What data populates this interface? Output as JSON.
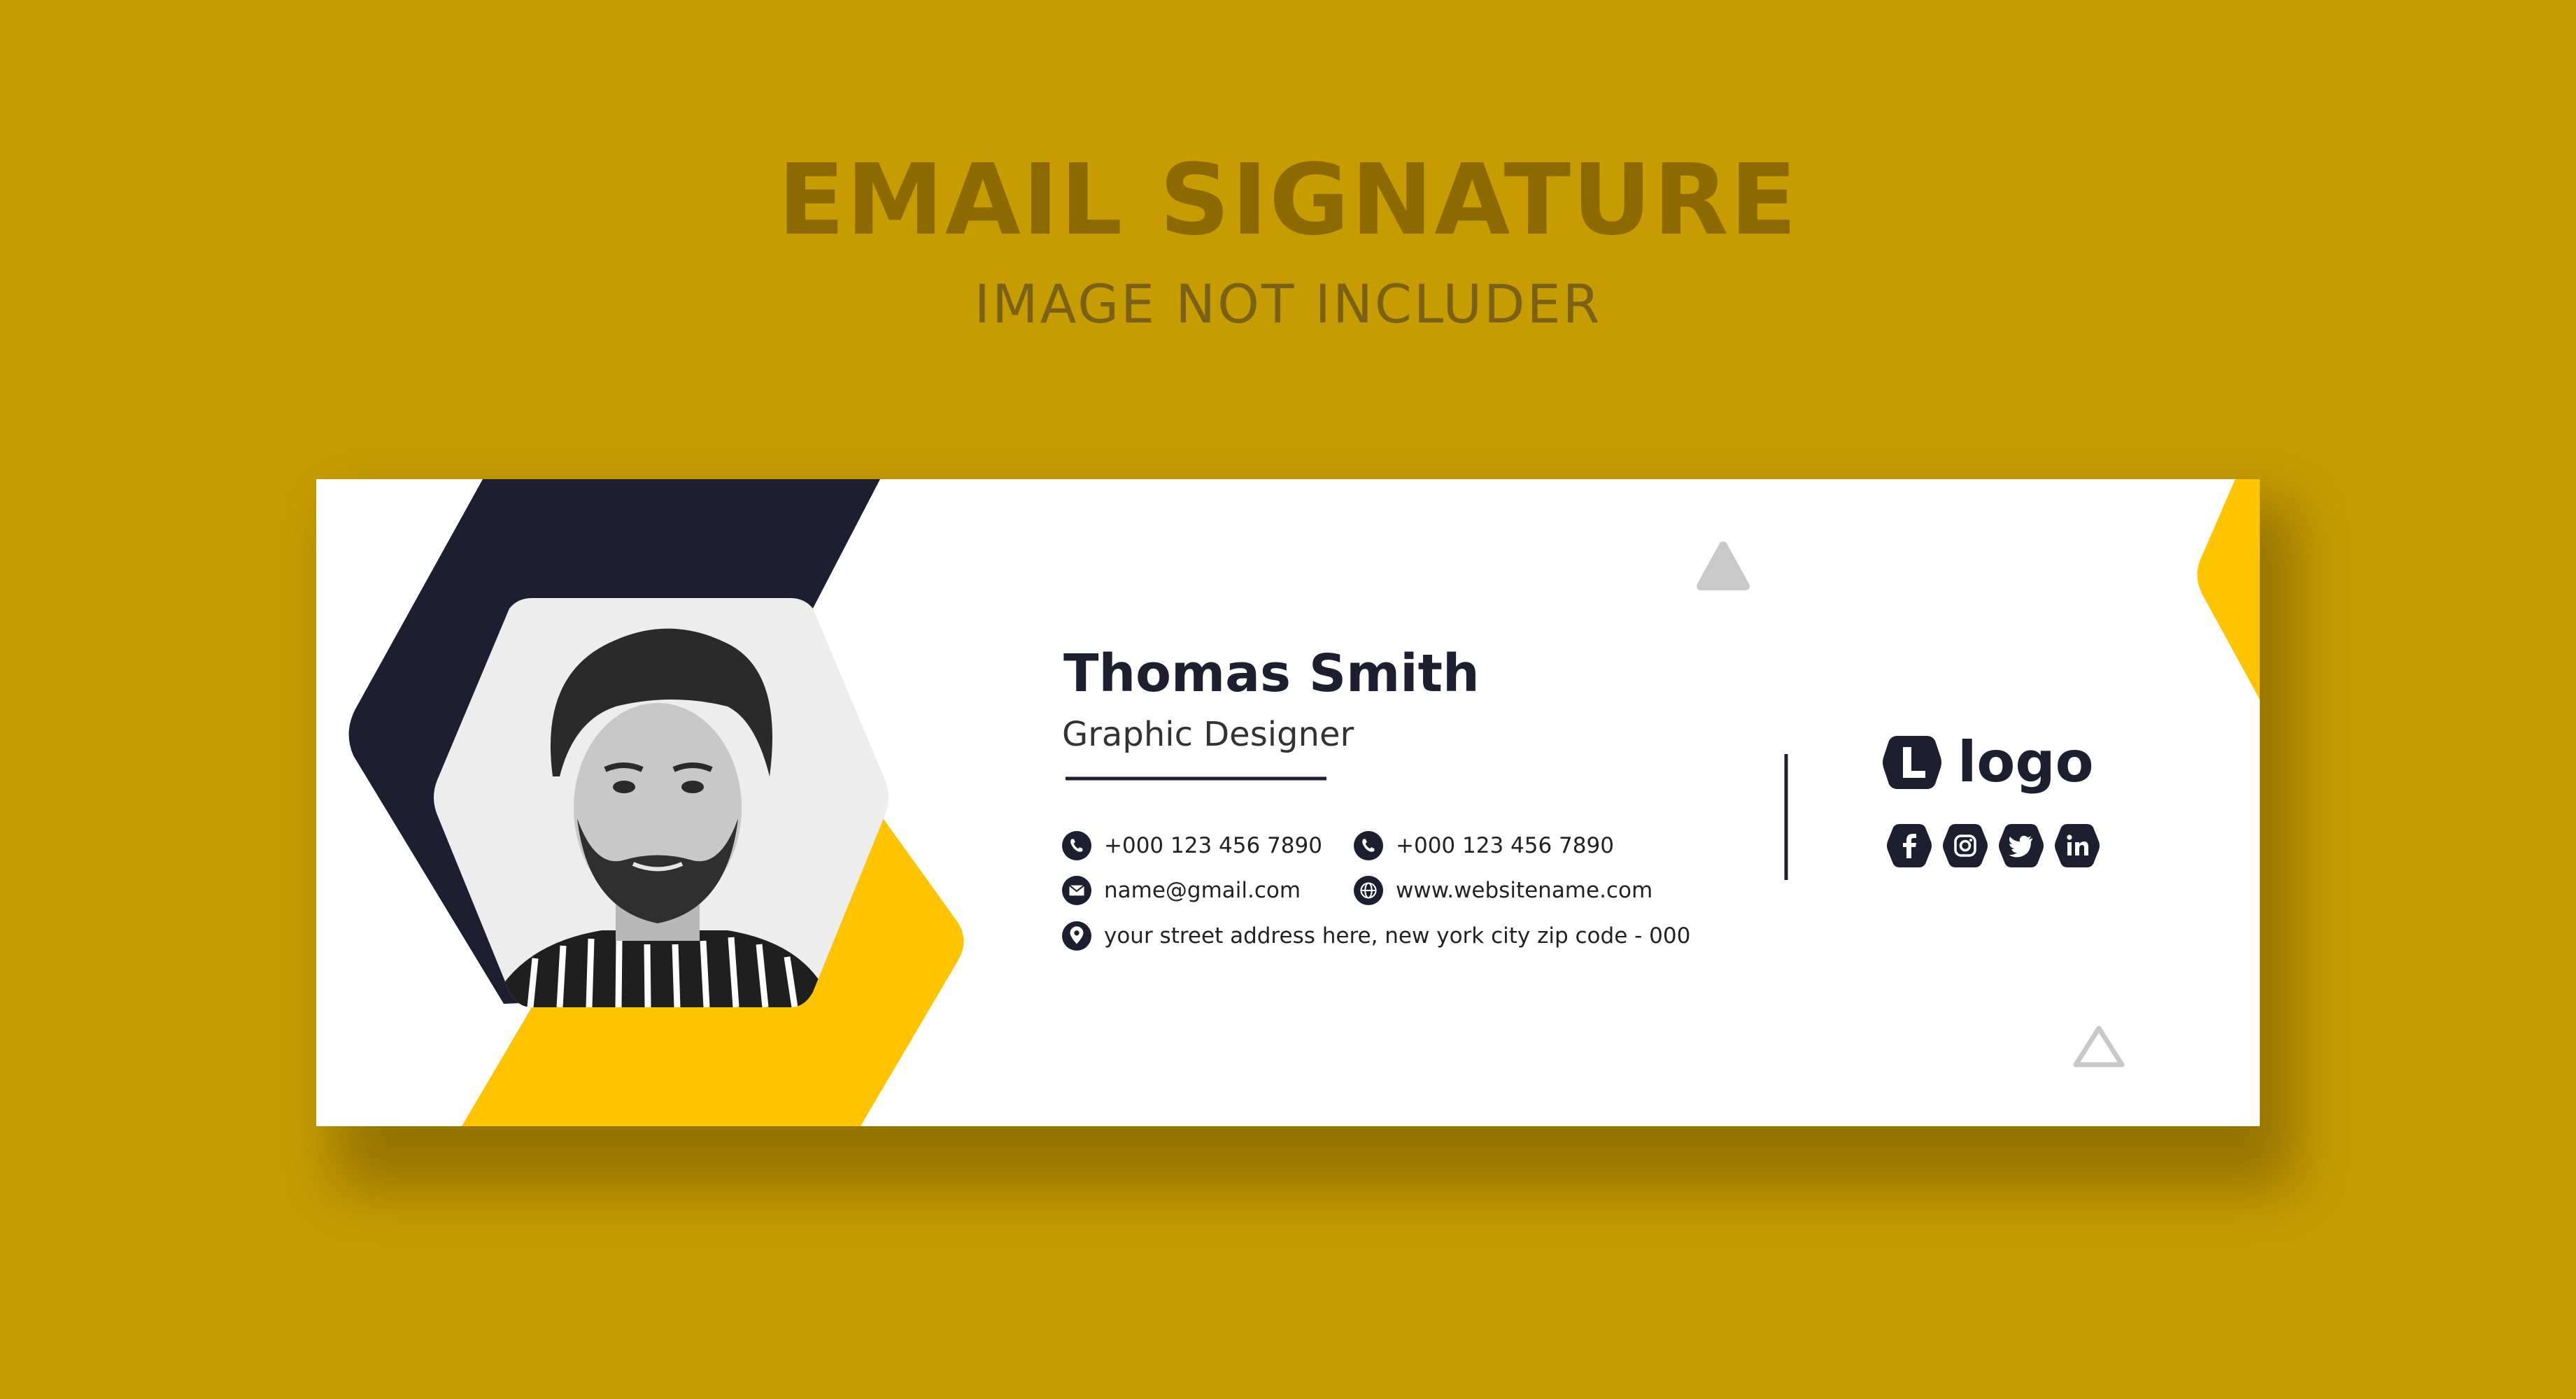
{
  "page": {
    "title": "EMAIL SIGNATURE",
    "subtitle": "IMAGE NOT INCLUDER"
  },
  "colors": {
    "background": "#C69C00",
    "heading": "#8C6A00",
    "subheading": "#7A6116",
    "card": "#FFFFFF",
    "navy": "#1D1F30",
    "yellow": "#FFC400",
    "text_dark": "#1D1F30",
    "text_body": "#333333",
    "triangle": "#C9C9C9"
  },
  "signature": {
    "name": "Thomas Smith",
    "role": "Graphic Designer",
    "photo_icon": "person-photo",
    "contacts": [
      {
        "icon": "phone-icon",
        "text": "+000 123 456 7890"
      },
      {
        "icon": "phone-icon",
        "text": "+000 123 456 7890"
      },
      {
        "icon": "email-icon",
        "text": "name@gmail.com"
      },
      {
        "icon": "globe-icon",
        "text": "www.websitename.com"
      },
      {
        "icon": "location-icon",
        "text": "your street address here, new york city zip code - 000"
      }
    ],
    "logo": {
      "icon": "l-logo-icon",
      "text": "logo"
    },
    "social": [
      {
        "icon": "facebook-icon",
        "label": "f"
      },
      {
        "icon": "instagram-icon",
        "label": "ig"
      },
      {
        "icon": "twitter-icon",
        "label": "tw"
      },
      {
        "icon": "linkedin-icon",
        "label": "in"
      }
    ]
  }
}
